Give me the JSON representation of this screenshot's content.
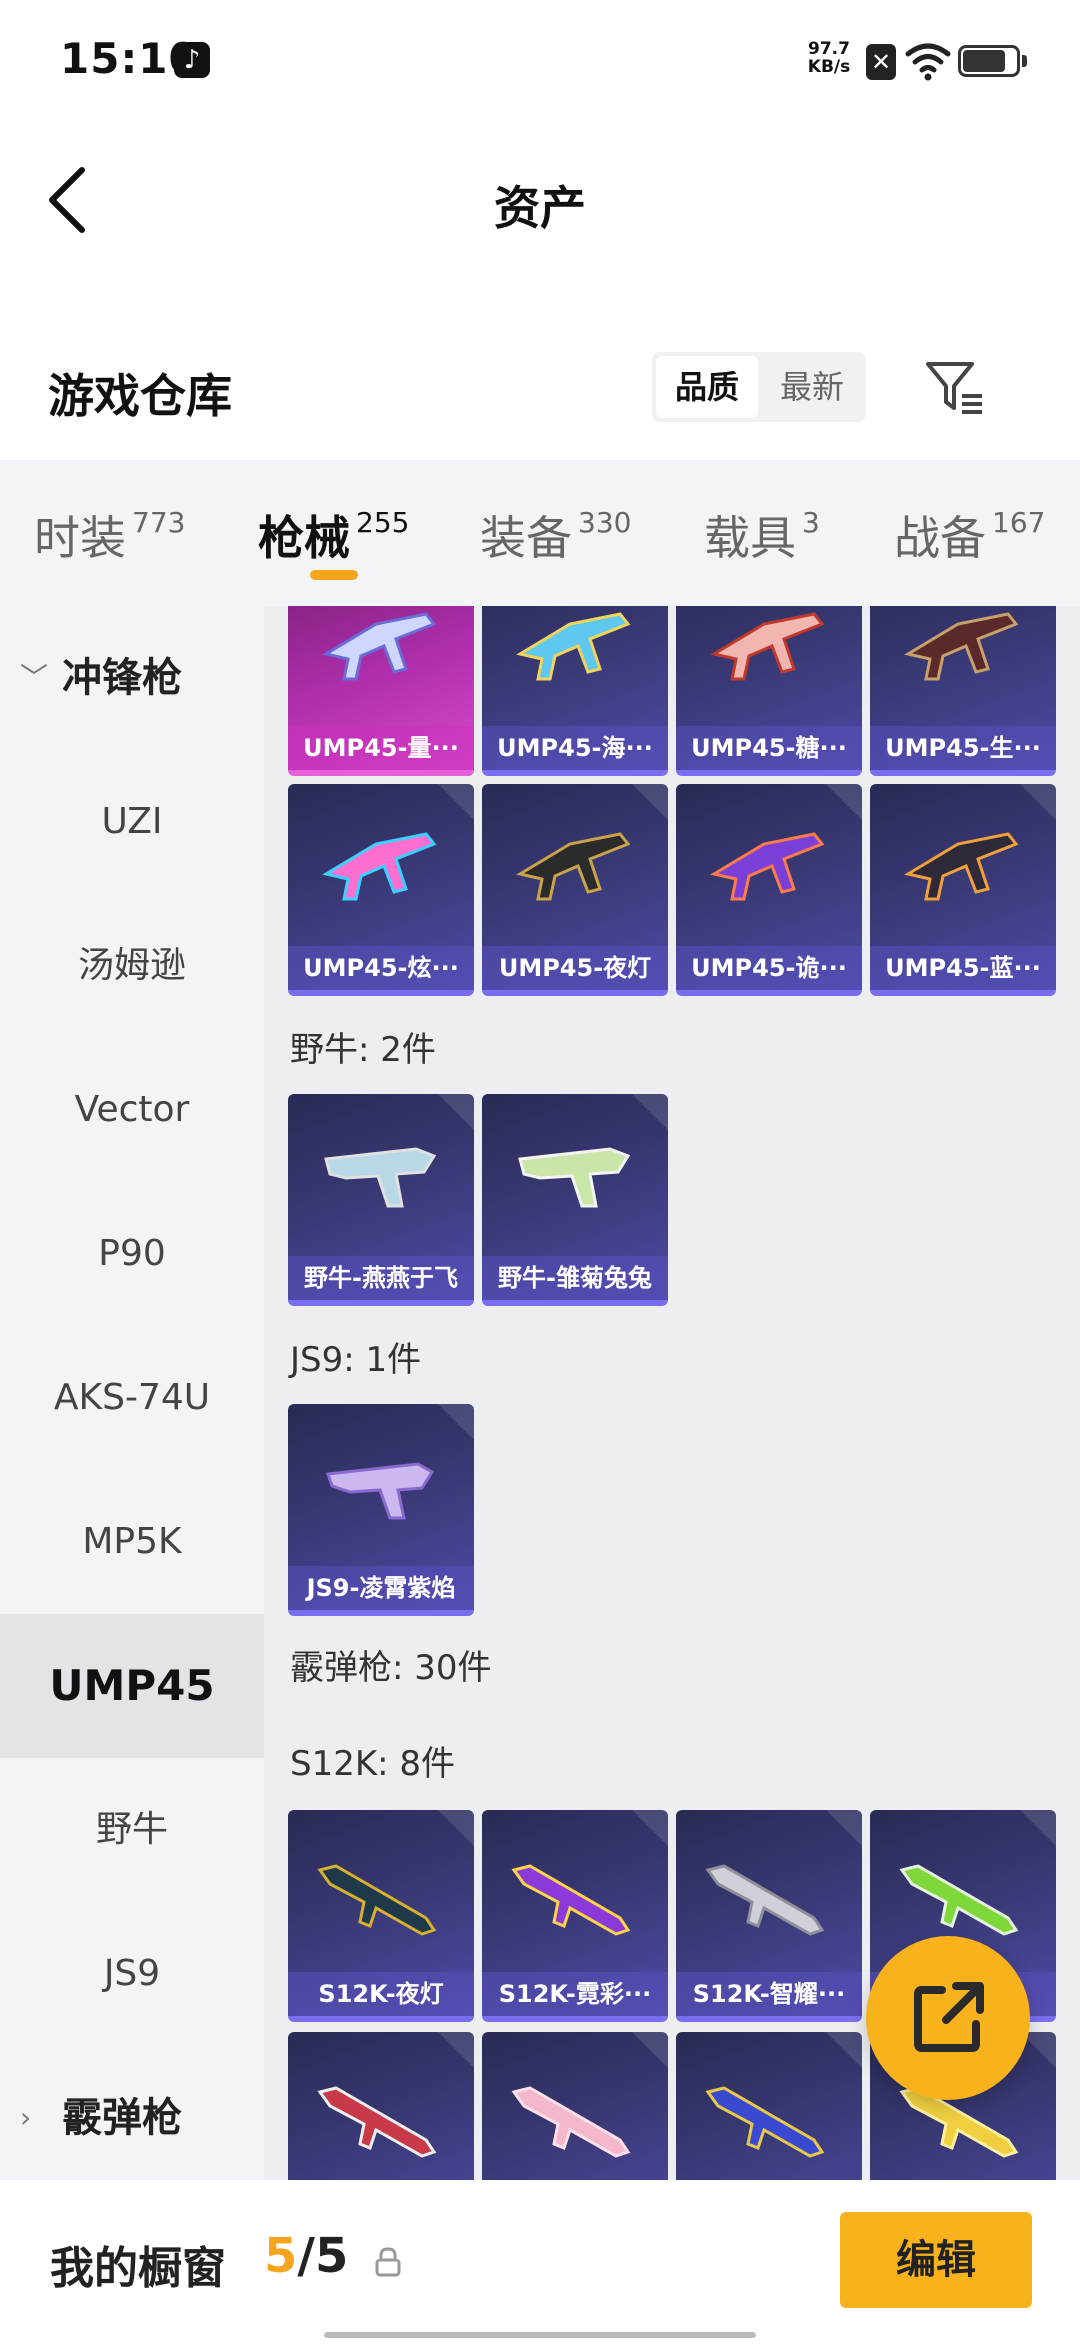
{
  "status_bar": {
    "time": "15:10",
    "net_speed_value": "97.7",
    "net_speed_unit": "KB/s",
    "icons": [
      "tiktok-icon",
      "sim-x-icon",
      "wifi-icon",
      "battery-icon"
    ]
  },
  "header": {
    "title": "资产"
  },
  "warehouse": {
    "title": "游戏仓库",
    "sort_options": [
      "品质",
      "最新"
    ],
    "sort_selected": "品质"
  },
  "tabs": [
    {
      "label": "时装",
      "count": "773"
    },
    {
      "label": "枪械",
      "count": "255",
      "active": true
    },
    {
      "label": "装备",
      "count": "330"
    },
    {
      "label": "载具",
      "count": "3"
    },
    {
      "label": "战备",
      "count": "167"
    }
  ],
  "sidebar": {
    "group_open": "冲锋枪",
    "items": [
      "UZI",
      "汤姆逊",
      "Vector",
      "P90",
      "AKS-74U",
      "MP5K",
      "UMP45",
      "野牛",
      "JS9"
    ],
    "selected": "UMP45",
    "group_closed": "霰弹枪"
  },
  "content": {
    "ump_row1": [
      "UMP45-量···",
      "UMP45-海···",
      "UMP45-糖···",
      "UMP45-生···"
    ],
    "ump_row2": [
      "UMP45-炫···",
      "UMP45-夜灯",
      "UMP45-诡···",
      "UMP45-蓝···"
    ],
    "bizon_title": "野牛: 2件",
    "bizon": [
      "野牛-燕燕于飞",
      "野牛-雏菊兔兔"
    ],
    "js9_title": "JS9: 1件",
    "js9": [
      "JS9-凌霄紫焰"
    ],
    "shotgun_title": "霰弹枪: 30件",
    "s12k_title": "S12K: 8件",
    "s12k_row1": [
      "S12K-夜灯",
      "S12K-霓彩···",
      "S12K-智耀···",
      ""
    ],
    "s12k_row2": [
      "",
      "",
      "",
      ""
    ]
  },
  "bottom_bar": {
    "label": "我的橱窗",
    "current": "5",
    "separator": "/",
    "total": "5",
    "edit_label": "编辑"
  },
  "colors": {
    "accent": "#f7a51d",
    "card_dark": "#383873",
    "card_pink": "#b12fae"
  }
}
